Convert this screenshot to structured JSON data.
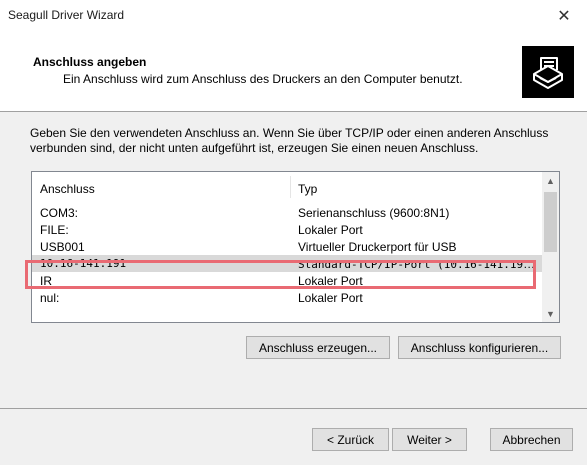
{
  "window": {
    "title": "Seagull Driver Wizard"
  },
  "header": {
    "title": "Anschluss angeben",
    "subtitle": "Ein Anschluss wird zum Anschluss des Druckers an den Computer benutzt."
  },
  "description": "Geben Sie den verwendeten Anschluss an. Wenn Sie über TCP/IP oder einen anderen Anschluss verbunden sind, der nicht unten aufgeführt ist, erzeugen Sie einen neuen Anschluss.",
  "port_list": {
    "columns": [
      "Anschluss",
      "Typ"
    ],
    "rows": [
      {
        "port": "COM3:",
        "type": "Serienanschluss (9600:8N1)"
      },
      {
        "port": "FILE:",
        "type": "Lokaler Port"
      },
      {
        "port": "USB001",
        "type": "Virtueller Druckerport für USB"
      },
      {
        "port": "10.16-141.191",
        "type": "Standard-TCP/IP-Port (10.16-141.191:...",
        "selected": true
      },
      {
        "port": "IR",
        "type": "Lokaler Port"
      },
      {
        "port": "nul:",
        "type": "Lokaler Port"
      }
    ]
  },
  "buttons": {
    "create_port": "Anschluss erzeugen...",
    "configure_port": "Anschluss konfigurieren...",
    "back": "< Zurück",
    "next": "Weiter >",
    "cancel": "Abbrechen"
  },
  "icons": {
    "close": "close-icon",
    "printer": "printer-icon",
    "scroll_up": "chevron-up-icon",
    "scroll_down": "chevron-down-icon"
  },
  "colors": {
    "highlight_border": "#e96a73",
    "selected_row": "#d9d9d9"
  }
}
